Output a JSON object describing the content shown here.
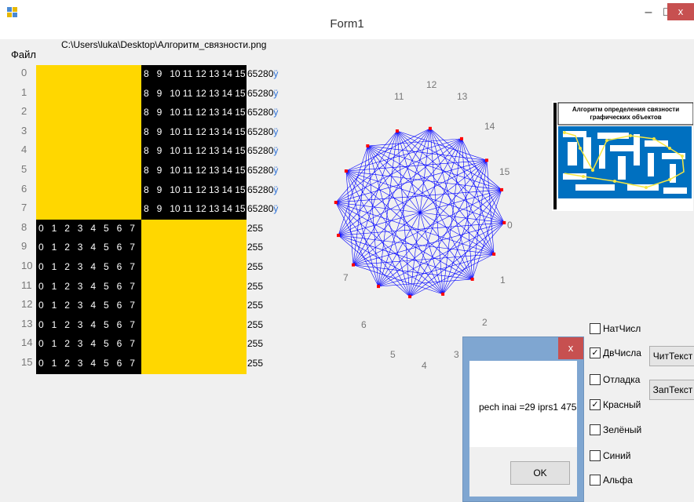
{
  "window": {
    "title": "Form1",
    "minimize": "–",
    "maximize": "□",
    "close": "x"
  },
  "menu": {
    "file": "Файл"
  },
  "file_path": "C:\\Users\\luka\\Desktop\\Алгоритм_связности.png",
  "grid": {
    "row_labels": [
      "0",
      "1",
      "2",
      "3",
      "4",
      "5",
      "6",
      "7",
      "8",
      "9",
      "10",
      "11",
      "12",
      "13",
      "14",
      "15"
    ],
    "top_row_cells": [
      "8",
      "9",
      "10",
      "11",
      "12",
      "13",
      "14",
      "15"
    ],
    "bottom_row_cells": [
      "0",
      "1",
      "2",
      "3",
      "4",
      "5",
      "6",
      "7"
    ],
    "top_value": "65280",
    "top_suffix": "ÿ",
    "bottom_value": "255",
    "colors": {
      "yellow": "#ffd700",
      "black": "#000000"
    }
  },
  "graph": {
    "node_labels": [
      "0",
      "1",
      "2",
      "3",
      "4",
      "5",
      "6",
      "7",
      "11",
      "12",
      "13",
      "14",
      "15"
    ],
    "edge_color": "#0000ff",
    "node_color": "#ff0000"
  },
  "preview": {
    "title": "Алгоритм определения связности графических объектов"
  },
  "checkboxes": [
    {
      "label": "НатЧисл",
      "checked": false
    },
    {
      "label": "ДвЧисла",
      "checked": true
    },
    {
      "label": "Отладка",
      "checked": false
    },
    {
      "label": "Красный",
      "checked": true
    },
    {
      "label": "Зелёный",
      "checked": false
    },
    {
      "label": "Синий",
      "checked": false
    },
    {
      "label": "Альфа",
      "checked": false
    }
  ],
  "buttons": {
    "read_text": "ЧитТекст",
    "write_text": "ЗапТекст"
  },
  "dialog": {
    "message": "pech inai =29 iprs1 475",
    "ok": "OK",
    "close": "x"
  }
}
